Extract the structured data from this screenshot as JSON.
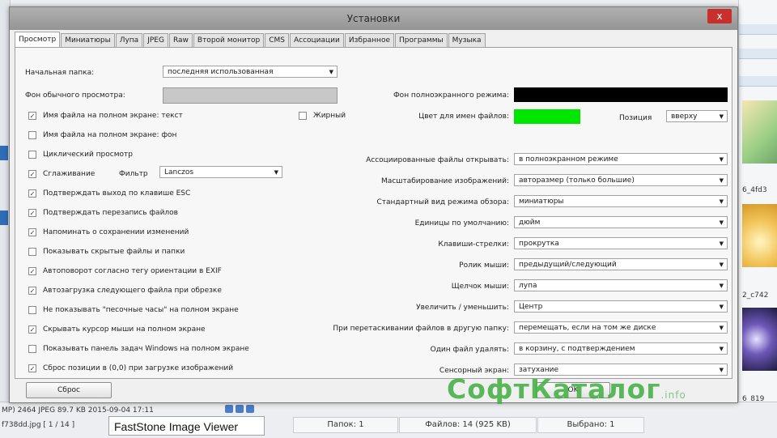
{
  "dialog": {
    "title": "Установки",
    "close_label": "x",
    "tabs": [
      "Просмотр",
      "Миниатюры",
      "Лупа",
      "JPEG",
      "Raw",
      "Второй монитор",
      "CMS",
      "Ассоциации",
      "Избранное",
      "Программы",
      "Музыка"
    ],
    "active_tab": "Просмотр",
    "left": {
      "start_folder_label": "Начальная папка:",
      "start_folder_value": "последняя использованная",
      "bg_normal_label": "Фон обычного просмотра:",
      "checkboxes": [
        {
          "label": "Имя файла на полном экране: текст",
          "checked": true
        },
        {
          "label": "Имя файла на полном экране: фон",
          "checked": false
        },
        {
          "label": "Циклический просмотр",
          "checked": false
        },
        {
          "label": "Сглаживание",
          "checked": true
        },
        {
          "label": "Подтверждать выход по клавише ESC",
          "checked": true
        },
        {
          "label": "Подтверждать перезапись файлов",
          "checked": true
        },
        {
          "label": "Напоминать о сохранении изменений",
          "checked": true
        },
        {
          "label": "Показывать скрытые файлы и папки",
          "checked": false
        },
        {
          "label": "Автоповорот согласно тегу ориентации в EXIF",
          "checked": true
        },
        {
          "label": "Автозагрузка следующего файла при обрезке",
          "checked": true
        },
        {
          "label": "Не показывать \"песочные часы\" на полном экране",
          "checked": false
        },
        {
          "label": "Скрывать курсор мыши на полном экране",
          "checked": true
        },
        {
          "label": "Показывать панель задач Windows на полном экране",
          "checked": false
        },
        {
          "label": "Сброс позиции в (0,0) при загрузке изображений",
          "checked": true
        }
      ],
      "bold_label": "Жирный",
      "bold_checked": false,
      "filter_label": "Фильтр",
      "filter_value": "Lanczos"
    },
    "right": {
      "bg_fullscreen_label": "Фон полноэкранного режима:",
      "filename_color_label": "Цвет для имен файлов:",
      "position_label": "Позиция",
      "position_value": "вверху",
      "rows": [
        {
          "label": "Ассоциированные файлы открывать:",
          "value": "в полноэкранном режиме"
        },
        {
          "label": "Масштабирование изображений:",
          "value": "авторазмер (только большие)"
        },
        {
          "label": "Стандартный вид режима обзора:",
          "value": "миниатюры"
        },
        {
          "label": "Единицы по умолчанию:",
          "value": "дюйм"
        },
        {
          "label": "Клавиши-стрелки:",
          "value": "прокрутка"
        },
        {
          "label": "Ролик мыши:",
          "value": "предыдущий/следующий"
        },
        {
          "label": "Щелчок мыши:",
          "value": "лупа"
        },
        {
          "label": "Увеличить / уменьшить:",
          "value": "Центр"
        },
        {
          "label": "При перетаскивании файлов в другую папку:",
          "value": "перемещать, если на том же диске"
        },
        {
          "label": "Один файл удалять:",
          "value": "в корзину, с подтверждением"
        },
        {
          "label": "Сенсорный экран:",
          "value": "затухание"
        }
      ]
    },
    "reset_button": "Сброс",
    "ok_button": "OK"
  },
  "colors": {
    "bg_normal": "#c8c8c8",
    "bg_fullscreen": "#000000",
    "filename_color": "#00e600"
  },
  "watermark": {
    "text": "СофтКаталог",
    "suffix": ".info"
  },
  "background": {
    "file_info": "MP) 2464 JPEG 89.7 KB 2015-09-04 17:11",
    "file_name": "f738dd.jpg [ 1 / 14 ]",
    "caption": "FastStone Image Viewer",
    "status": [
      "Папок: 1",
      "Файлов: 14 (925 KB)",
      "Выбрано: 1"
    ],
    "thumb_labels": [
      "6_4fd3",
      "2_c742",
      "6_819"
    ]
  }
}
